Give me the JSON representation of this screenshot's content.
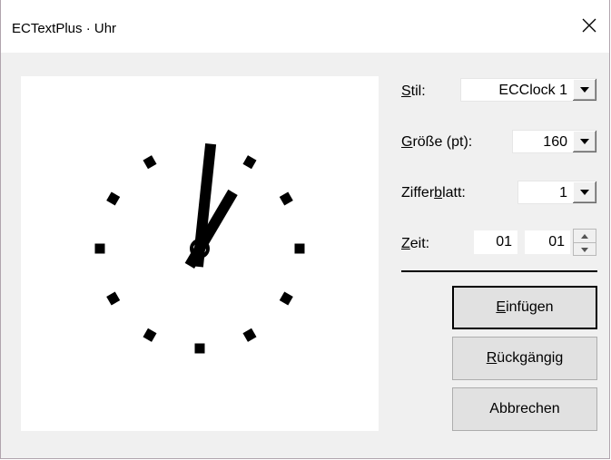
{
  "window": {
    "title": "ECTextPlus · Uhr",
    "close_icon": "close-icon"
  },
  "clock": {
    "hour": 1,
    "minute": 1,
    "markers": 12
  },
  "form": {
    "stil_label_u": "S",
    "stil_label_rest": "til:",
    "stil_value": "ECClock 1",
    "groesse_label_u": "G",
    "groesse_label_rest": "röße (pt):",
    "groesse_value": "160",
    "ziffer_label_a": "Ziffer",
    "ziffer_label_u": "b",
    "ziffer_label_b": "latt:",
    "ziffer_value": "1",
    "zeit_label_u": "Z",
    "zeit_label_rest": "eit:",
    "zeit_hours": "01",
    "zeit_minutes": "01"
  },
  "buttons": {
    "insert_u": "E",
    "insert_rest": "infügen",
    "undo_u": "R",
    "undo_rest": "ückgängig",
    "cancel": "Abbrechen"
  }
}
